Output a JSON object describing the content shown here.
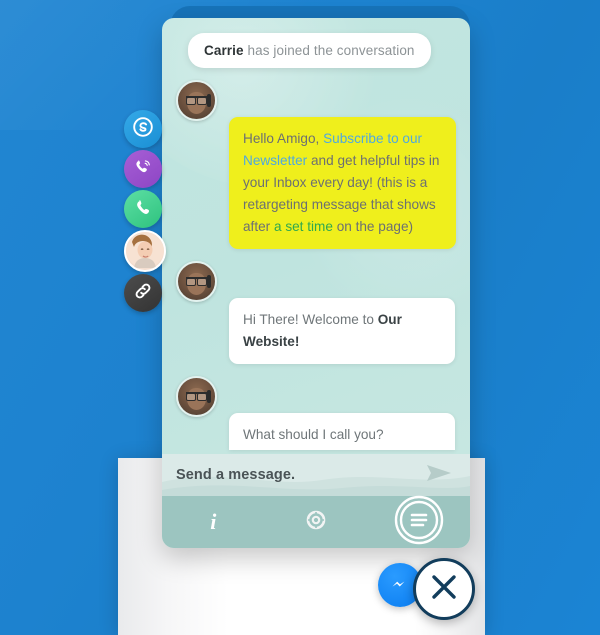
{
  "theme": {
    "page_bg": "#1d82cf",
    "plate_bg": "#1773b9",
    "widget_bg": "#c2e6e0",
    "composer_bg": "#dbeae8",
    "toolbar_bg": "#9cc5c0",
    "highlight_bubble": "#efef1c",
    "link_blue": "#4fa8e0",
    "link_green": "#2fa84f",
    "messenger_blue": "#0a7cf0"
  },
  "social_rail": {
    "items": [
      {
        "name": "skype",
        "label": "Skype",
        "icon": "skype-icon",
        "color": "#1a8fd4"
      },
      {
        "name": "viber",
        "label": "Viber",
        "icon": "viber-icon",
        "color": "#8d45c4"
      },
      {
        "name": "whatsapp",
        "label": "WhatsApp",
        "icon": "whatsapp-icon",
        "color": "#2ec27e"
      },
      {
        "name": "operator",
        "label": "Operator",
        "icon": "avatar-photo",
        "color": "#f4ded0"
      },
      {
        "name": "link",
        "label": "Copy link",
        "icon": "link-icon",
        "color": "#333333"
      }
    ]
  },
  "chat": {
    "notice": {
      "name": "Carrie",
      "text": " has joined the conversation"
    },
    "messages": [
      {
        "id": "promo",
        "style": "yellow",
        "parts": [
          {
            "t": "Hello Amigo, ",
            "k": "plain"
          },
          {
            "t": "Subscribe to our Newsletter",
            "k": "link-blue"
          },
          {
            "t": " and get helpful tips in your Inbox every day! (this is a",
            "k": "plain"
          },
          {
            "t": "\nretargeting message that shows after ",
            "k": "plain"
          },
          {
            "t": "a set time",
            "k": "link-green"
          },
          {
            "t": " on the page)",
            "k": "plain"
          }
        ]
      },
      {
        "id": "welcome",
        "style": "white",
        "parts": [
          {
            "t": "Hi There! Welcome to ",
            "k": "plain"
          },
          {
            "t": "Our Website!",
            "k": "bold"
          }
        ]
      },
      {
        "id": "ask-name",
        "style": "white-partial",
        "parts": [
          {
            "t": "What should I call you?",
            "k": "plain"
          }
        ]
      }
    ]
  },
  "composer": {
    "placeholder": "Send a message.",
    "value": "",
    "send_icon": "send-arrow-icon"
  },
  "toolbar": {
    "buttons": [
      {
        "name": "info",
        "icon": "info-icon",
        "label": "i"
      },
      {
        "name": "help",
        "icon": "lifebuoy-icon",
        "label": ""
      },
      {
        "name": "menu",
        "icon": "hamburger-icon",
        "label": ""
      }
    ]
  },
  "launchers": [
    {
      "name": "messenger",
      "icon": "facebook-messenger-icon",
      "label": "Messenger"
    },
    {
      "name": "close",
      "icon": "close-x-icon",
      "label": "Close"
    }
  ]
}
